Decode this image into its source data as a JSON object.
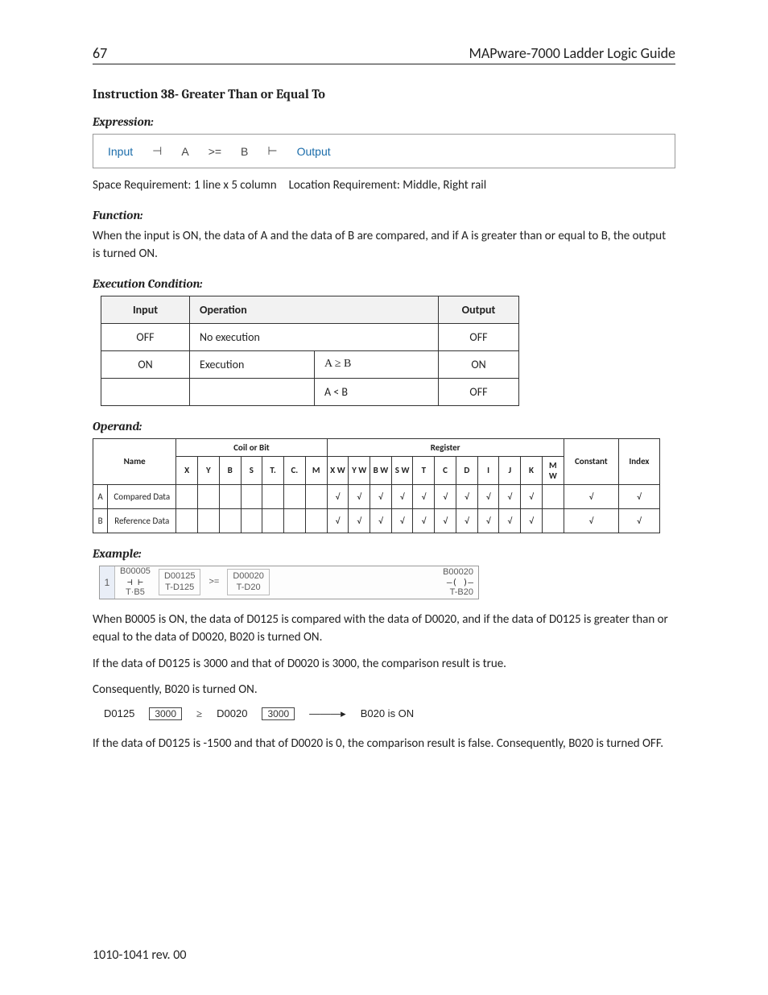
{
  "header": {
    "page_num": "67",
    "title": "MAPware-7000 Ladder Logic Guide"
  },
  "section_title": "Instruction 38- Greater Than or Equal To",
  "expression": {
    "heading": "Expression:",
    "input_label": "Input",
    "symbol_left": "⊣",
    "A": "A",
    "op": ">=",
    "B": "B",
    "symbol_right": "⊢",
    "output_label": "Output"
  },
  "space_loc": "Space Requirement: 1 line x 5 column Location Requirement: Middle, Right rail",
  "function": {
    "heading": "Function:",
    "body": "When the input is ON, the data of A and the data of B are compared, and if A is greater than or equal to B, the output is turned ON."
  },
  "exec": {
    "heading": "Execution Condition:",
    "th_input": "Input",
    "th_operation": "Operation",
    "th_output": "Output",
    "rows": [
      {
        "input": "OFF",
        "op": "No execution",
        "cond": "",
        "out": "OFF"
      },
      {
        "input": "ON",
        "op": "Execution",
        "cond": "A ≥ B",
        "out": "ON"
      },
      {
        "input": "",
        "op": "",
        "cond": "A < B",
        "out": "OFF"
      }
    ]
  },
  "operand": {
    "heading": "Operand:",
    "group_coil": "Coil or Bit",
    "group_reg": "Register",
    "group_const": "Constant",
    "group_index": "Index",
    "name": "Name",
    "cols_coil": [
      "X",
      "Y",
      "B",
      "S",
      "T.",
      "C.",
      "M"
    ],
    "cols_reg": [
      "X W",
      "Y W",
      "B W",
      "S W",
      "T",
      "C",
      "D",
      "I",
      "J",
      "K",
      "M W"
    ],
    "rows": [
      {
        "idx": "A",
        "name": "Compared Data",
        "coil": [
          "",
          "",
          "",
          "",
          "",
          "",
          ""
        ],
        "reg": [
          "√",
          "√",
          "√",
          "√",
          "√",
          "√",
          "√",
          "√",
          "√",
          "√",
          ""
        ],
        "const": "√",
        "index": "√"
      },
      {
        "idx": "B",
        "name": "Reference Data",
        "coil": [
          "",
          "",
          "",
          "",
          "",
          "",
          ""
        ],
        "reg": [
          "√",
          "√",
          "√",
          "√",
          "√",
          "√",
          "√",
          "√",
          "√",
          "√",
          ""
        ],
        "const": "√",
        "index": "√"
      }
    ]
  },
  "example": {
    "heading": "Example:",
    "rung": "1",
    "contact": {
      "top": "B00005",
      "bot": "T·B5"
    },
    "a": {
      "top": "D00125",
      "bot": "T-D125"
    },
    "op": ">=",
    "b": {
      "top": "D00020",
      "bot": "T-D20"
    },
    "coil": {
      "top": "B00020",
      "bot": "T-B20"
    }
  },
  "para1": "When B0005 is ON, the data of D0125 is compared with the data of D0020, and if the data of D0125 is greater than or equal to the data of D0020, B020 is turned ON.",
  "para2": "If the data of D0125 is 3000 and that of D0020 is 3000, the comparison result is true.",
  "para3": "Consequently, B020 is turned ON.",
  "cmp": {
    "a_label": "D0125",
    "a_val": "3000",
    "op": "≥",
    "b_label": "D0020",
    "b_val": "3000",
    "arrow": "———▸",
    "result": "B020 is ON"
  },
  "para4": "If the data of D0125 is -1500 and that of D0020 is 0, the comparison result is false. Consequently, B020 is turned OFF.",
  "footer": "1010-1041 rev. 00"
}
